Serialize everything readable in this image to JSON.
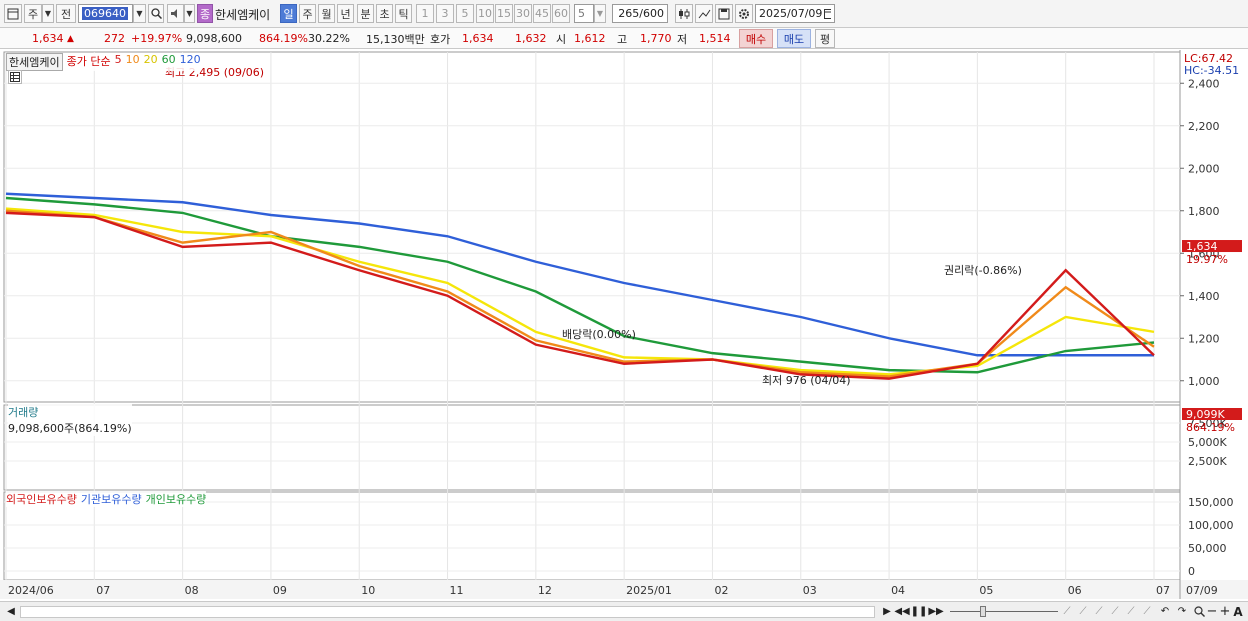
{
  "toolbar": {
    "menu_icon": "window-menu-icon",
    "market_label": "주",
    "prev_label": "전",
    "code": "069640",
    "stock_name": "한세엠케이",
    "stock_badge": "종",
    "period_tabs": [
      "일",
      "주",
      "월",
      "년",
      "분",
      "초",
      "틱"
    ],
    "active_period": "일",
    "interval_buttons": [
      "1",
      "3",
      "5",
      "10",
      "15",
      "30",
      "45",
      "60"
    ],
    "interval_value": "5",
    "count_current": "265",
    "count_total": "/600",
    "date": "2025/07/09"
  },
  "quote": {
    "price": "1,634",
    "change_arrow": "▲",
    "change": "272",
    "change_pct": "+19.97%",
    "volume": "9,098,600",
    "volume_pct": "864.19%",
    "turnover": "30.22%",
    "amount": "15,130백만",
    "hoga_label": "호가",
    "ask": "1,634",
    "bid": "1,632",
    "open_label": "시",
    "open": "1,612",
    "high_label": "고",
    "high": "1,770",
    "low_label": "저",
    "low": "1,514",
    "buy_label": "매수",
    "sell_label": "매도",
    "flat_label": "평"
  },
  "price_panel": {
    "title": "한세엠케이",
    "ma_label": "종가 단순",
    "ma_periods": [
      "5",
      "10",
      "20",
      "60",
      "120"
    ],
    "ma_colors": [
      "#d31b1b",
      "#f08a1a",
      "#f5e60a",
      "#1f9a3a",
      "#2f5fd8"
    ],
    "lc": "LC:67.42",
    "hc": "HC:-34.51",
    "current_tag": "1,634",
    "current_pct": "19.97%",
    "high_note": "최고 2,495 (09/06)",
    "low_note": "최저 976 (04/04)",
    "ex_rights_note": "권리락(-0.86%)",
    "ex_div_note": "배당락(0.00%)",
    "y_ticks": [
      "2,400",
      "2,200",
      "2,000",
      "1,800",
      "1,600",
      "1,400",
      "1,200",
      "1,000"
    ]
  },
  "volume_panel": {
    "title": "거래량",
    "value": "9,098,600주(864.19%)",
    "current_tag": "9,099K",
    "current_pct": "864.19%",
    "y_ticks": [
      "7,500K",
      "5,000K",
      "2,500K"
    ]
  },
  "holder_panel": {
    "series": [
      "외국인보유수량",
      "기관보유수량",
      "개인보유수량"
    ],
    "colors": [
      "#d31b1b",
      "#2f5fd8",
      "#1f9a3a"
    ],
    "y_ticks": [
      "150,000",
      "100,000",
      "50,000",
      "0"
    ]
  },
  "x_axis": {
    "labels": [
      "2024/06",
      "07",
      "08",
      "09",
      "10",
      "11",
      "12",
      "2025/01",
      "02",
      "03",
      "04",
      "05",
      "06",
      "07"
    ],
    "right_label": "07/09"
  },
  "chart_data": {
    "type": "line",
    "title": "한세엠케이",
    "x": [
      "2024/06",
      "07",
      "08",
      "09",
      "10",
      "11",
      "12",
      "2025/01",
      "02",
      "03",
      "04",
      "05",
      "06",
      "07"
    ],
    "ylim": [
      900,
      2500
    ],
    "series": [
      {
        "name": "5",
        "values": [
          1790,
          1770,
          1630,
          1650,
          1520,
          1400,
          1170,
          1080,
          1100,
          1030,
          1010,
          1080,
          1520,
          1120
        ]
      },
      {
        "name": "10",
        "values": [
          1800,
          1770,
          1650,
          1700,
          1540,
          1420,
          1190,
          1090,
          1100,
          1040,
          1020,
          1080,
          1440,
          1160
        ]
      },
      {
        "name": "20",
        "values": [
          1810,
          1780,
          1700,
          1680,
          1560,
          1460,
          1230,
          1110,
          1100,
          1050,
          1030,
          1070,
          1300,
          1230
        ]
      },
      {
        "name": "60",
        "values": [
          1860,
          1830,
          1790,
          1680,
          1630,
          1560,
          1420,
          1210,
          1130,
          1090,
          1050,
          1040,
          1140,
          1180
        ]
      },
      {
        "name": "120",
        "values": [
          1880,
          1860,
          1840,
          1780,
          1740,
          1680,
          1560,
          1460,
          1380,
          1300,
          1200,
          1120,
          1120,
          1120
        ]
      }
    ]
  }
}
